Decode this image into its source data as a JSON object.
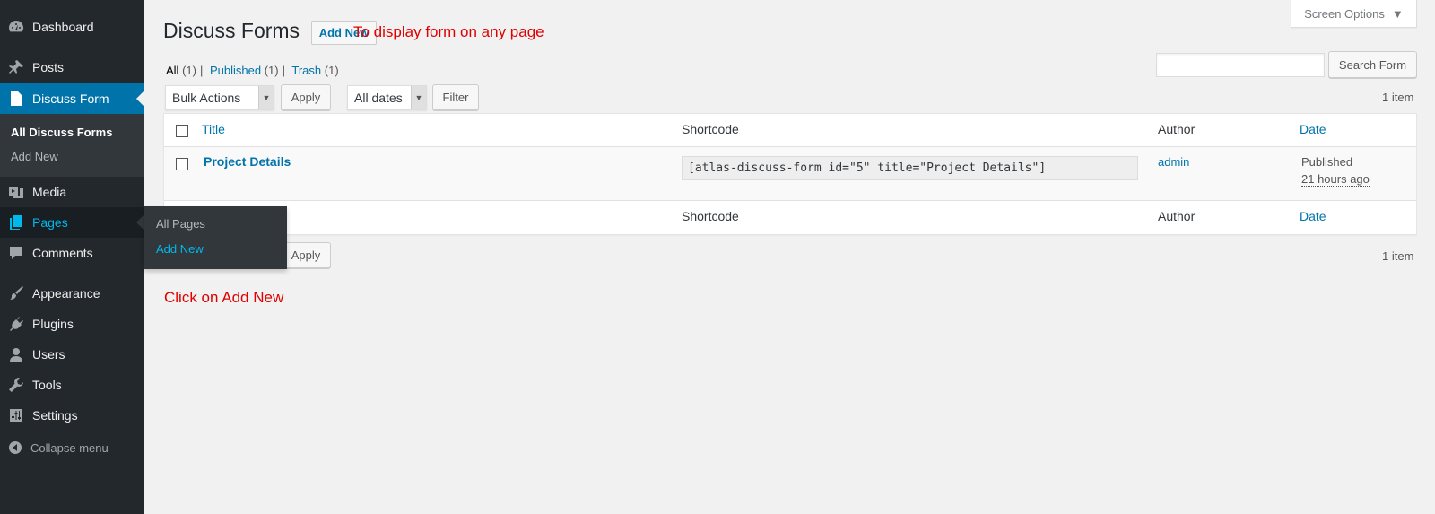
{
  "sidebar": {
    "dashboard": "Dashboard",
    "posts": "Posts",
    "discuss_form": "Discuss Form",
    "submenu": {
      "all": "All Discuss Forms",
      "add_new": "Add New"
    },
    "media": "Media",
    "pages": "Pages",
    "comments": "Comments",
    "appearance": "Appearance",
    "plugins": "Plugins",
    "users": "Users",
    "tools": "Tools",
    "settings": "Settings",
    "collapse": "Collapse menu"
  },
  "flyout": {
    "all_pages": "All Pages",
    "add_new": "Add New"
  },
  "header": {
    "screen_options": "Screen Options",
    "title": "Discuss Forms",
    "add_new": "Add New"
  },
  "annotations": {
    "top": "To display form on any page",
    "bottom": "Click on Add New"
  },
  "filters": {
    "all": "All",
    "all_count": "(1)",
    "published": "Published",
    "published_count": "(1)",
    "trash": "Trash",
    "trash_count": "(1)"
  },
  "search": {
    "value": "",
    "button": "Search Form"
  },
  "tablenav": {
    "bulk_actions": "Bulk Actions",
    "apply": "Apply",
    "dates": "All dates",
    "filter": "Filter",
    "items": "1 item"
  },
  "table": {
    "columns": {
      "title": "Title",
      "shortcode": "Shortcode",
      "author": "Author",
      "date": "Date"
    },
    "rows": [
      {
        "title": "Project Details",
        "shortcode": "[atlas-discuss-form id=\"5\" title=\"Project Details\"]",
        "author": "admin",
        "status": "Published",
        "ago": "21 hours ago"
      }
    ]
  },
  "colors": {
    "sidebar_bg": "#23282d",
    "accent": "#0073aa",
    "highlight": "#00b9eb",
    "annotation": "#e00000"
  }
}
